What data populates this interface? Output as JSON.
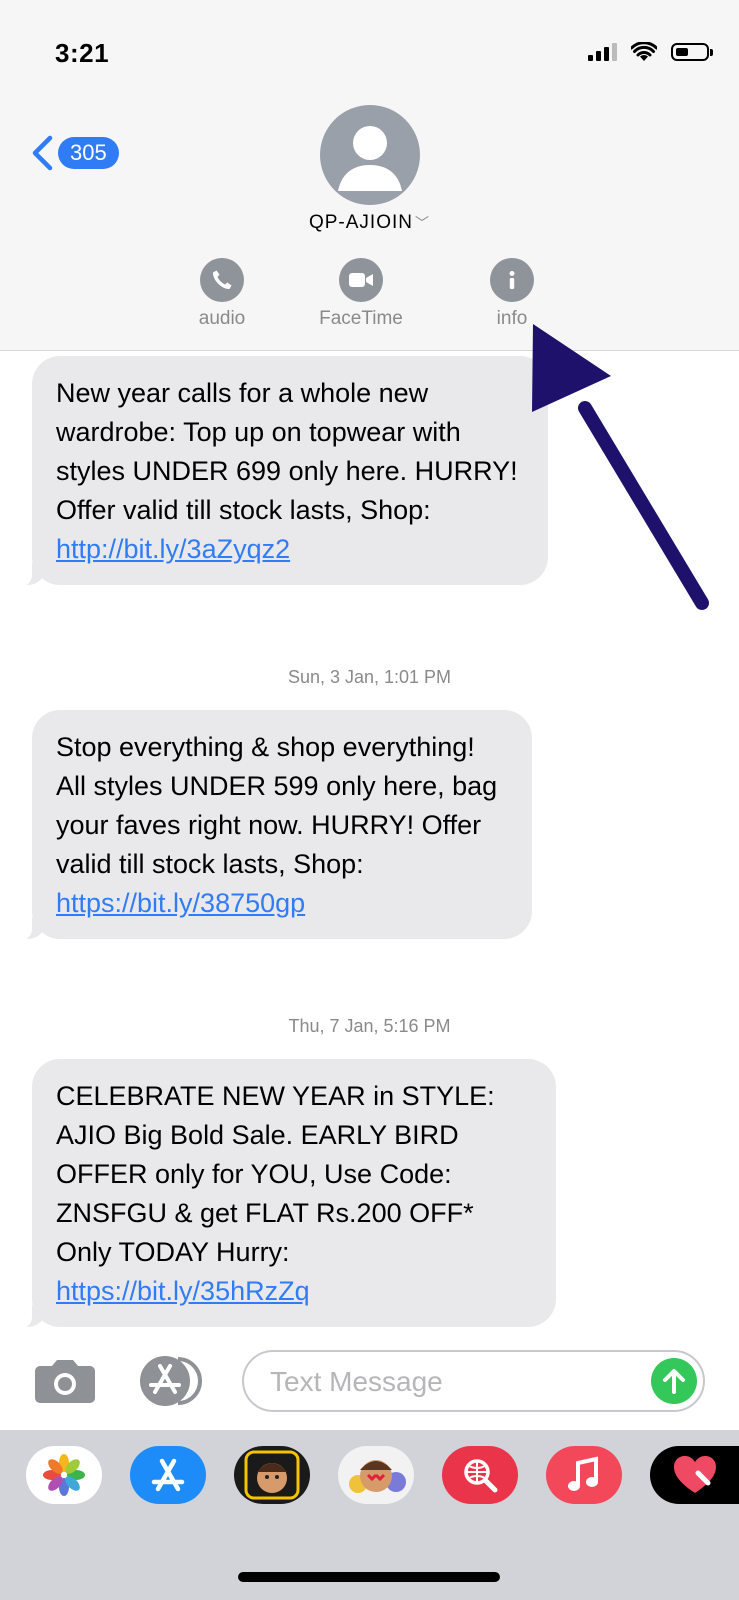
{
  "status_bar": {
    "time": "3:21"
  },
  "header": {
    "back_count": "305",
    "contact_name": "QP-AJIOIN",
    "actions": [
      {
        "label": "audio",
        "icon": "phone-icon"
      },
      {
        "label": "FaceTime",
        "icon": "video-icon"
      },
      {
        "label": "info",
        "icon": "info-icon"
      }
    ]
  },
  "messages": [
    {
      "text": "New year calls for a whole new wardrobe: Top up on topwear with styles UNDER 699 only here. HURRY! Offer valid till stock lasts, Shop: ",
      "link": "http://bit.ly/3aZyqz2"
    },
    {
      "timestamp": "Sun, 3 Jan, 1:01 PM",
      "text": "Stop everything & shop everything! All styles UNDER 599 only here, bag your faves right now. HURRY! Offer valid till stock lasts, Shop: ",
      "link": "https://bit.ly/38750gp"
    },
    {
      "timestamp": "Thu, 7 Jan, 5:16 PM",
      "text": "CELEBRATE NEW YEAR in STYLE: AJIO Big Bold Sale. EARLY BIRD OFFER only for YOU, Use Code: ZNSFGU & get FLAT Rs.200 OFF* Only TODAY Hurry: ",
      "link": "https://bit.ly/35hRzZq"
    }
  ],
  "composer": {
    "placeholder": "Text Message"
  },
  "app_drawer": {
    "apps": [
      "photos-app",
      "app-store-app",
      "memoji-app",
      "animoji-app",
      "web-search-app",
      "music-app",
      "digital-touch-app"
    ]
  },
  "colors": {
    "accent": "#2f7cf6",
    "bubble": "#e9e9eb",
    "arrow": "#1e116b",
    "send": "#34c759"
  }
}
